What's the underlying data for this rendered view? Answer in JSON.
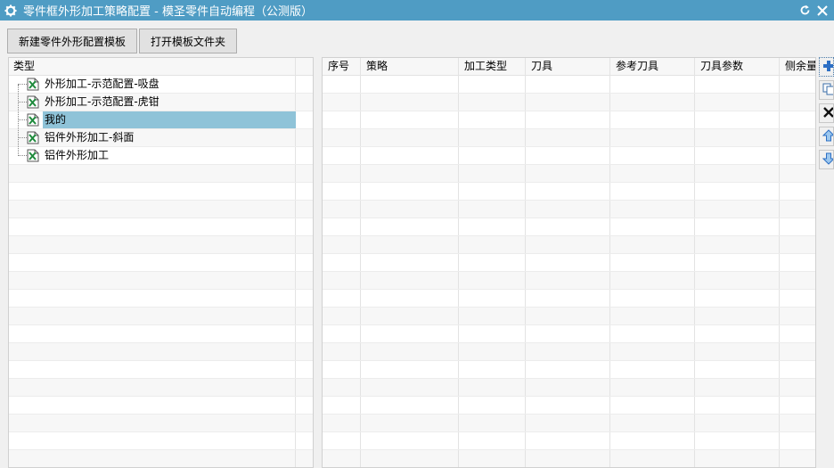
{
  "window": {
    "title": "零件框外形加工策略配置 - 模圣零件自动编程（公测版）"
  },
  "toolbar": {
    "new_label": "新建零件外形配置模板",
    "open_label": "打开模板文件夹"
  },
  "tree": {
    "header": "类型",
    "items": [
      {
        "label": "外形加工-示范配置-吸盘",
        "selected": false
      },
      {
        "label": "外形加工-示范配置-虎钳",
        "selected": false
      },
      {
        "label": "我的",
        "selected": true
      },
      {
        "label": "铝件外形加工-斜面",
        "selected": false
      },
      {
        "label": "铝件外形加工",
        "selected": false
      }
    ]
  },
  "grid": {
    "columns": [
      "序号",
      "策略",
      "加工类型",
      "刀具",
      "参考刀具",
      "刀具参数",
      "侧余量"
    ]
  },
  "side_buttons": [
    "add-icon",
    "copy-icon",
    "delete-icon",
    "move-up-icon",
    "move-down-icon"
  ],
  "colors": {
    "titlebar": "#4f9cc4",
    "selection": "#8fc3d8"
  }
}
